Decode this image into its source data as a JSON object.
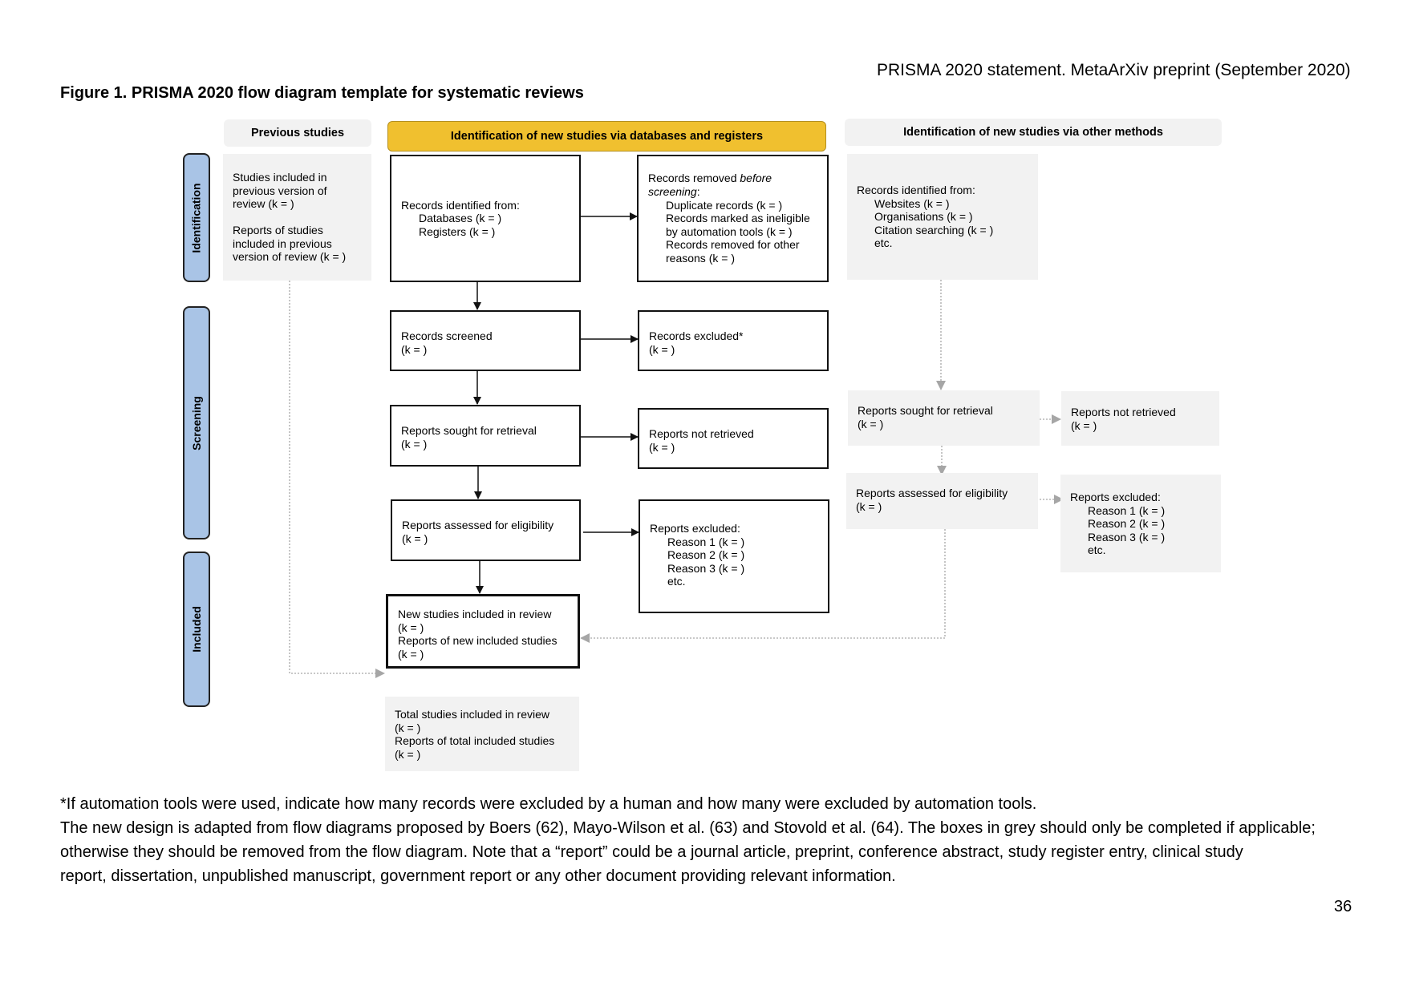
{
  "page": {
    "running_head": "PRISMA 2020 statement. MetaArXiv preprint (September 2020)",
    "figure_title": "Figure 1. PRISMA 2020 flow diagram template for systematic reviews",
    "page_number": "36"
  },
  "column_headers": {
    "previous": "Previous studies",
    "databases": "Identification of new studies via databases and registers",
    "other": "Identification of new studies via other methods"
  },
  "phase_tabs": {
    "identification": "Identification",
    "screening": "Screening",
    "included": "Included"
  },
  "previous_studies_box": {
    "line1": "Studies included in",
    "line2": "previous version of",
    "line3": "review (k = )",
    "line4": "Reports of studies",
    "line5": "included in previous",
    "line6": "version of review (k = )"
  },
  "databases": {
    "records_identified": {
      "title": "Records identified from:",
      "items": [
        "Databases (k = )",
        "Registers (k = )"
      ]
    },
    "records_removed": {
      "title_prefix": "Records removed ",
      "title_em": "before",
      "title_line2_em": "screening",
      "title_line2_suffix": ":",
      "items": [
        "Duplicate records (k = )",
        "Records marked as ineligible",
        "by automation tools (k = )",
        "Records removed for other",
        "reasons (k = )"
      ]
    },
    "records_screened": {
      "title": "Records screened",
      "count": "(k = )"
    },
    "records_excluded": {
      "title": "Records excluded*",
      "count": "(k = )"
    },
    "reports_sought": {
      "title": "Reports sought for retrieval",
      "count": "(k = )"
    },
    "reports_not_retrieved": {
      "title": "Reports not retrieved",
      "count": "(k = )"
    },
    "reports_assessed": {
      "title": "Reports assessed for eligibility",
      "count": "(k = )"
    },
    "reports_excluded": {
      "title": "Reports excluded:",
      "items": [
        "Reason 1 (k = )",
        "Reason 2 (k = )",
        "Reason 3 (k = )",
        "etc."
      ]
    },
    "new_studies_included": {
      "line1": "New studies included in review",
      "line2": "(k = )",
      "line3": "Reports of new included studies",
      "line4": "(k = )"
    }
  },
  "other_methods": {
    "records_identified": {
      "title": "Records identified from:",
      "items": [
        "Websites (k = )",
        "Organisations (k = )",
        "Citation searching (k = )",
        "etc."
      ]
    },
    "reports_sought": {
      "title": "Reports sought for retrieval",
      "count": "(k = )"
    },
    "reports_not_retrieved": {
      "title": "Reports not retrieved",
      "count": "(k = )"
    },
    "reports_assessed": {
      "title": "Reports assessed for eligibility",
      "count": "(k = )"
    },
    "reports_excluded": {
      "title": "Reports excluded:",
      "items": [
        "Reason 1 (k = )",
        "Reason 2 (k = )",
        "Reason 3 (k = )",
        "etc."
      ]
    }
  },
  "total_included": {
    "line1": "Total studies included in review",
    "line2": "(k = )",
    "line3": "Reports of total included studies",
    "line4": "(k = )"
  },
  "footnotes": [
    "*If automation tools were used, indicate how many records were excluded by a human and how many were excluded by automation tools.",
    "The new design is adapted from flow diagrams proposed by Boers (62), Mayo-Wilson et al. (63) and Stovold et al. (64). The boxes in grey should only be completed if applicable;",
    "otherwise they should be removed from the flow diagram. Note that a “report” could be a journal article, preprint, conference abstract, study register entry, clinical study",
    "report, dissertation, unpublished manuscript, government report or any other document providing relevant information."
  ],
  "colors": {
    "databases_header": "#f0c02f",
    "phase_tab": "#a9c4e6",
    "grey_box": "#f2f2f2",
    "grey_arrow": "#a6a6a6"
  }
}
